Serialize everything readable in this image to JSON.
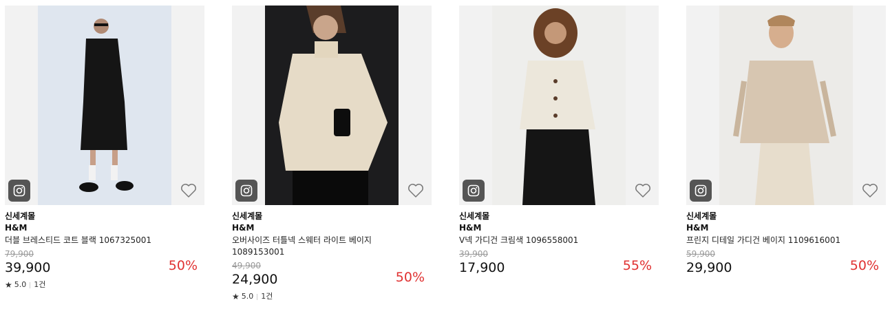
{
  "products": [
    {
      "mall": "신세계몰",
      "brand": "H&M",
      "name": "더블 브레스티드 코트 블랙 1067325001",
      "original_price": "79,900",
      "price": "39,900",
      "discount": "50%",
      "rating": "5.0",
      "review_count": "1건",
      "icons": [
        "instagram-icon",
        "heart-icon",
        "star-icon"
      ]
    },
    {
      "mall": "신세계몰",
      "brand": "H&M",
      "name": "오버사이즈 터틀넥 스웨터 라이트 베이지 1089153001",
      "original_price": "49,900",
      "price": "24,900",
      "discount": "50%",
      "rating": "5.0",
      "review_count": "1건",
      "icons": [
        "instagram-icon",
        "heart-icon",
        "star-icon"
      ]
    },
    {
      "mall": "신세계몰",
      "brand": "H&M",
      "name": "V넥 가디건 크림색 1096558001",
      "original_price": "39,900",
      "price": "17,900",
      "discount": "55%",
      "icons": [
        "instagram-icon",
        "heart-icon"
      ]
    },
    {
      "mall": "신세계몰",
      "brand": "H&M",
      "name": "프린지 디테일 가디건 베이지 1109616001",
      "original_price": "59,900",
      "price": "29,900",
      "discount": "50%",
      "icons": [
        "instagram-icon",
        "heart-icon"
      ]
    }
  ],
  "colors": {
    "discount": "#e03131",
    "original_price": "#999999",
    "thumb_bg": "#f2f2f2",
    "insta_badge": "#555555"
  }
}
